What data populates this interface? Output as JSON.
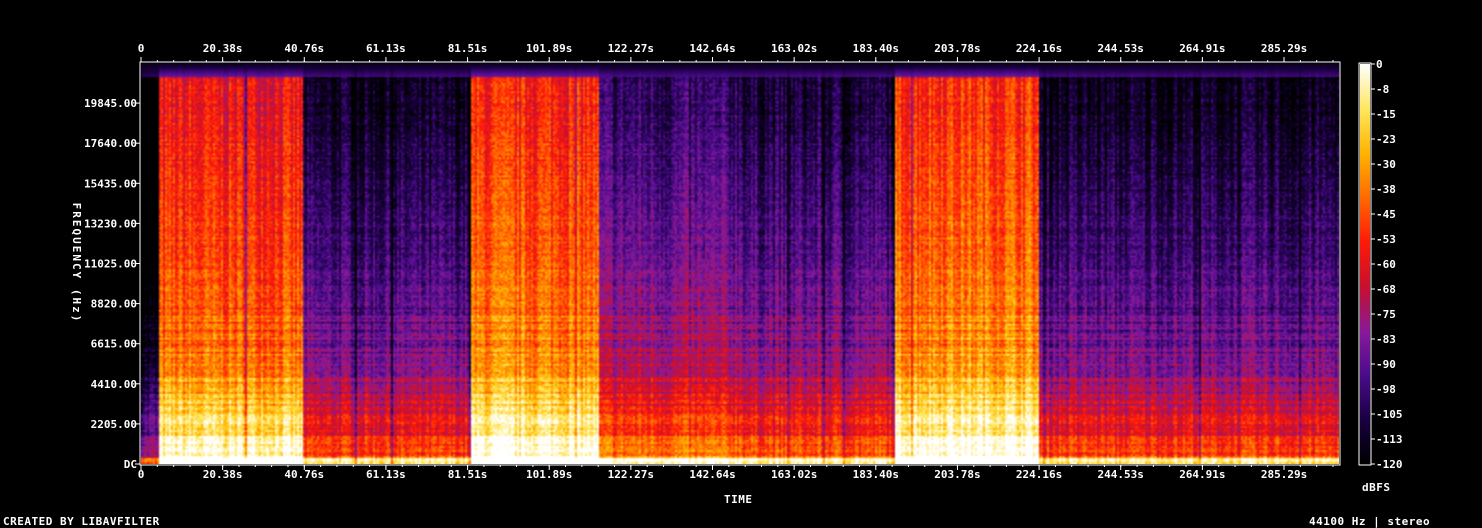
{
  "chart_data": {
    "type": "heatmap",
    "title": "",
    "xlabel": "TIME",
    "ylabel": "FREQUENCY (Hz)",
    "x_ticks_top": [
      "0",
      "20.38s",
      "40.76s",
      "61.13s",
      "81.51s",
      "101.89s",
      "122.27s",
      "142.64s",
      "163.02s",
      "183.40s",
      "203.78s",
      "224.16s",
      "244.53s",
      "264.91s",
      "285.29s"
    ],
    "x_ticks_bottom": [
      "0",
      "20.38s",
      "40.76s",
      "61.13s",
      "81.51s",
      "101.89s",
      "122.27s",
      "142.64s",
      "163.02s",
      "183.40s",
      "203.78s",
      "224.16s",
      "244.53s",
      "264.91s",
      "285.29s"
    ],
    "y_ticks": [
      "DC",
      "2205.00",
      "4410.00",
      "6615.00",
      "8820.00",
      "11025.00",
      "13230.00",
      "15435.00",
      "17640.00",
      "19845.00"
    ],
    "xlim": [
      0,
      299
    ],
    "ylim": [
      0,
      22050
    ],
    "colorbar_ticks": [
      "0",
      "-8",
      "-15",
      "-23",
      "-30",
      "-38",
      "-45",
      "-53",
      "-60",
      "-68",
      "-75",
      "-83",
      "-90",
      "-98",
      "-105",
      "-113",
      "-120"
    ],
    "colorbar_unit": "dBFS",
    "clim": [
      -120,
      0
    ],
    "colormap": [
      "#000000",
      "#1a0040",
      "#4b0c8c",
      "#8a1a9a",
      "#c8102e",
      "#ff1a0a",
      "#ff6a00",
      "#ffb400",
      "#ffe860",
      "#ffffff"
    ],
    "segments": [
      {
        "start": 0,
        "end": 4,
        "level": 0.35
      },
      {
        "start": 4,
        "end": 40,
        "level": 0.85
      },
      {
        "start": 40,
        "end": 82,
        "level": 0.55
      },
      {
        "start": 82,
        "end": 114,
        "level": 0.88
      },
      {
        "start": 114,
        "end": 150,
        "level": 0.62
      },
      {
        "start": 150,
        "end": 188,
        "level": 0.58
      },
      {
        "start": 188,
        "end": 224,
        "level": 0.9
      },
      {
        "start": 224,
        "end": 299,
        "level": 0.55
      }
    ]
  },
  "footer": {
    "left": "CREATED BY LIBAVFILTER",
    "right": "44100 Hz | stereo"
  }
}
